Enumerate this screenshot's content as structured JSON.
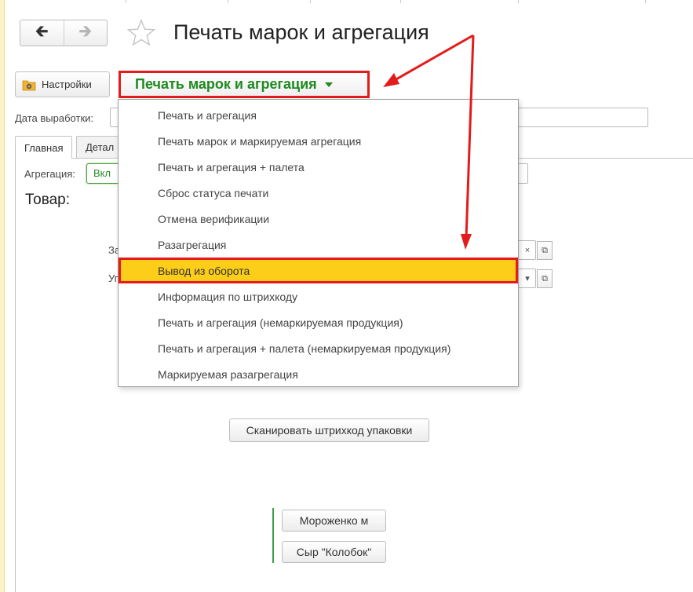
{
  "window": {
    "title": "Печать марок и агрегация"
  },
  "nav": {
    "back_icon": "arrow-left-icon",
    "forward_icon": "arrow-right-icon",
    "favorite_icon": "star-icon"
  },
  "toolbar": {
    "settings_label": "Настройки",
    "main_button_label": "Печать марок и агрегация"
  },
  "form": {
    "date_label": "Дата выработки:",
    "tabs": [
      {
        "label": "Главная"
      },
      {
        "label": "Детал"
      }
    ],
    "aggregation_label": "Агрегация:",
    "aggregation_button": "Вкл",
    "product_heading": "Товар:",
    "field1_label": "За",
    "field2_label": "Уг",
    "scan_button": "Сканировать штрихкод упаковки",
    "product_buttons": [
      {
        "label": "Мороженко м"
      },
      {
        "label": "Сыр \"Колобок\""
      }
    ]
  },
  "menu": {
    "items": [
      {
        "label": "Печать и агрегация"
      },
      {
        "label": "Печать марок и маркируемая агрегация"
      },
      {
        "label": "Печать и агрегация + палета"
      },
      {
        "label": "Сброс статуса печати"
      },
      {
        "label": "Отмена верификации"
      },
      {
        "label": "Разагрегация"
      },
      {
        "label": "Вывод из оборота"
      },
      {
        "label": "Информация по штрихкоду"
      },
      {
        "label": "Печать и агрегация (немаркируемая продукция)"
      },
      {
        "label": "Печать и агрегация + палета (немаркируемая продукция)"
      },
      {
        "label": "Маркируемая разагрегация"
      }
    ],
    "highlighted_index": 6
  },
  "colors": {
    "accent_green": "#1f8a1f",
    "highlight_yellow": "#fccd19",
    "annotation_red": "#e31b1b"
  }
}
